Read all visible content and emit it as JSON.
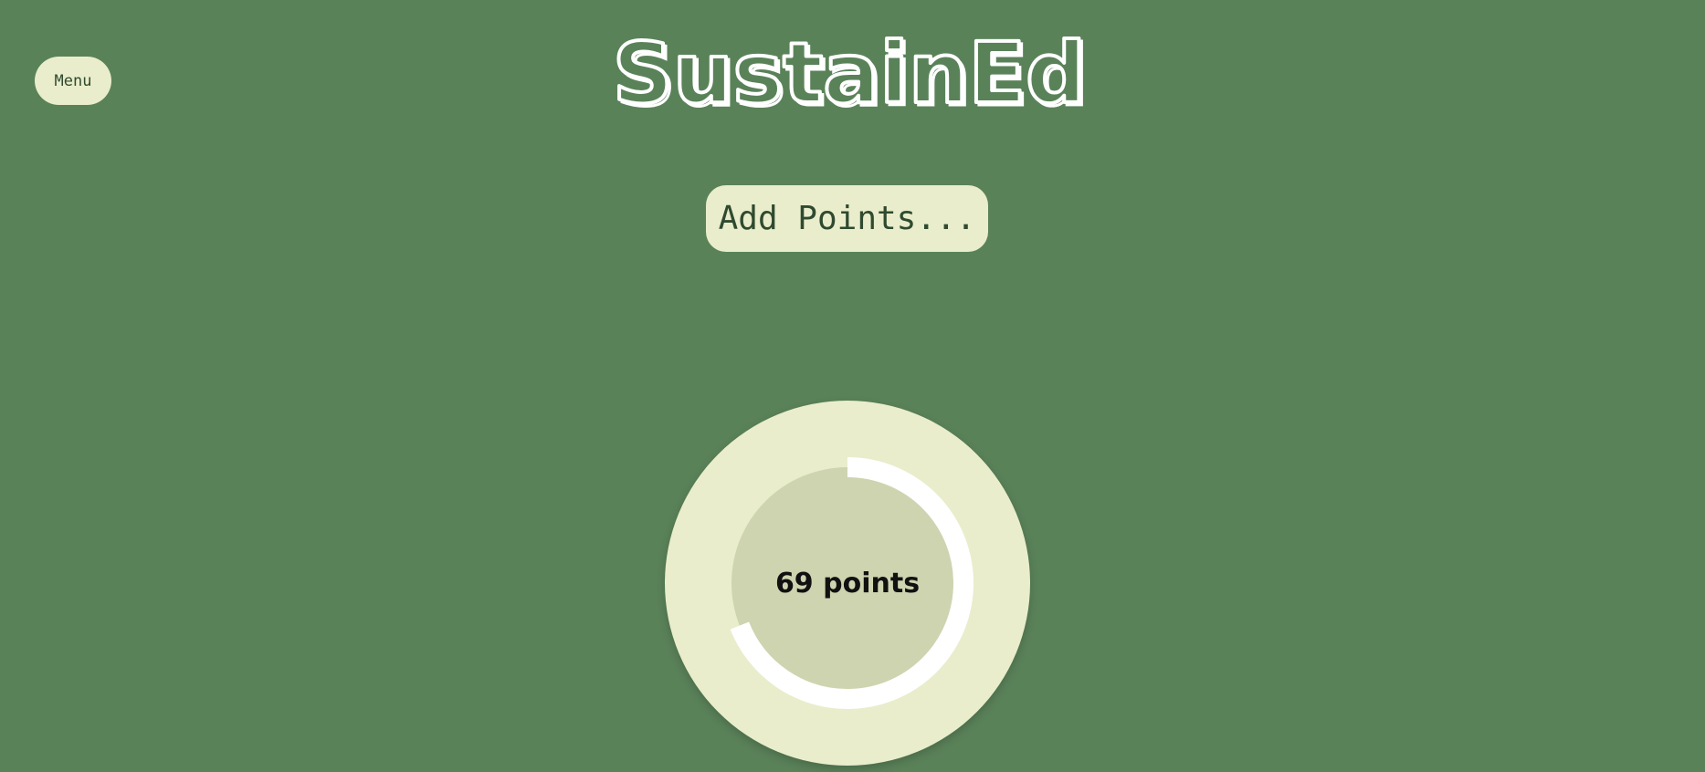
{
  "menu": {
    "label": "Menu"
  },
  "logo": {
    "text": "SustainEd"
  },
  "add_points": {
    "label": "Add Points..."
  },
  "progress": {
    "points": 69,
    "max_points": 100,
    "label": "69 points"
  },
  "colors": {
    "background": "#5a8259",
    "button_bg": "#e9edcb",
    "inner_circle": "#cfd4b0",
    "progress_arc": "#ffffff",
    "text_dark": "#2f4a2f"
  }
}
